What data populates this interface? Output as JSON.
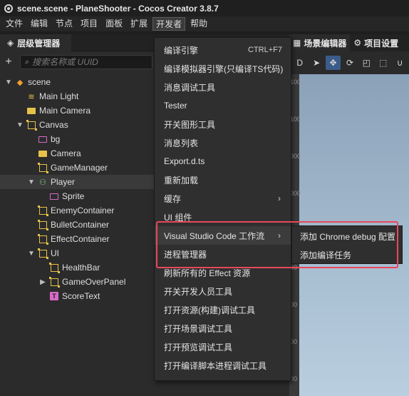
{
  "window": {
    "title": "scene.scene - PlaneShooter - Cocos Creator 3.8.7"
  },
  "menubar": {
    "items": [
      {
        "label": "文件"
      },
      {
        "label": "编辑"
      },
      {
        "label": "节点"
      },
      {
        "label": "项目"
      },
      {
        "label": "面板"
      },
      {
        "label": "扩展"
      },
      {
        "label": "开发者"
      },
      {
        "label": "帮助"
      }
    ]
  },
  "hierarchy": {
    "tab_label": "层级管理器",
    "search_placeholder": "搜索名称或 UUID",
    "nodes": [
      {
        "label": "scene",
        "icon": "scene-icon"
      },
      {
        "label": "Main Light",
        "icon": "light-icon"
      },
      {
        "label": "Main Camera",
        "icon": "camera-icon"
      },
      {
        "label": "Canvas",
        "icon": "frame-icon"
      },
      {
        "label": "bg",
        "icon": "sprite-icon"
      },
      {
        "label": "Camera",
        "icon": "camera-icon"
      },
      {
        "label": "GameManager",
        "icon": "frame-icon"
      },
      {
        "label": "Player",
        "icon": "node-icon"
      },
      {
        "label": "Sprite",
        "icon": "sprite-icon"
      },
      {
        "label": "EnemyContainer",
        "icon": "frame-icon"
      },
      {
        "label": "BulletContainer",
        "icon": "frame-icon"
      },
      {
        "label": "EffectContainer",
        "icon": "frame-icon"
      },
      {
        "label": "UI",
        "icon": "frame-icon"
      },
      {
        "label": "HealthBar",
        "icon": "frame-icon"
      },
      {
        "label": "GameOverPanel",
        "icon": "frame-icon"
      },
      {
        "label": "ScoreText",
        "icon": "text-icon"
      }
    ]
  },
  "scene_panel": {
    "tabs": [
      {
        "label": "场景编辑器"
      },
      {
        "label": "项目设置"
      }
    ],
    "mode_label": "D",
    "ruler_labels": [
      "100",
      "100",
      "000",
      "000",
      "00",
      "00",
      "00",
      "00",
      "00",
      "00",
      "00"
    ]
  },
  "developer_menu": {
    "items": [
      {
        "label": "编译引擎",
        "shortcut": "CTRL+F7"
      },
      {
        "label": "编译模拟器引擎(只编译TS代码)"
      },
      {
        "label": "消息调试工具"
      },
      {
        "label": "Tester"
      },
      {
        "label": "开关图形工具"
      },
      {
        "label": "消息列表"
      },
      {
        "label": "Export.d.ts"
      },
      {
        "label": "重新加载"
      },
      {
        "label": "缓存"
      },
      {
        "label": "UI 组件"
      },
      {
        "label": "Visual Studio Code 工作流"
      },
      {
        "label": "进程管理器"
      },
      {
        "label": "刷新所有的 Effect 资源"
      },
      {
        "label": "开关开发人员工具"
      },
      {
        "label": "打开资源(构建)调试工具"
      },
      {
        "label": "打开场景调试工具"
      },
      {
        "label": "打开预览调试工具"
      },
      {
        "label": "打开编译脚本进程调试工具"
      }
    ]
  },
  "vscode_submenu": {
    "items": [
      {
        "label": "添加 Chrome debug 配置"
      },
      {
        "label": "添加编译任务"
      }
    ]
  }
}
